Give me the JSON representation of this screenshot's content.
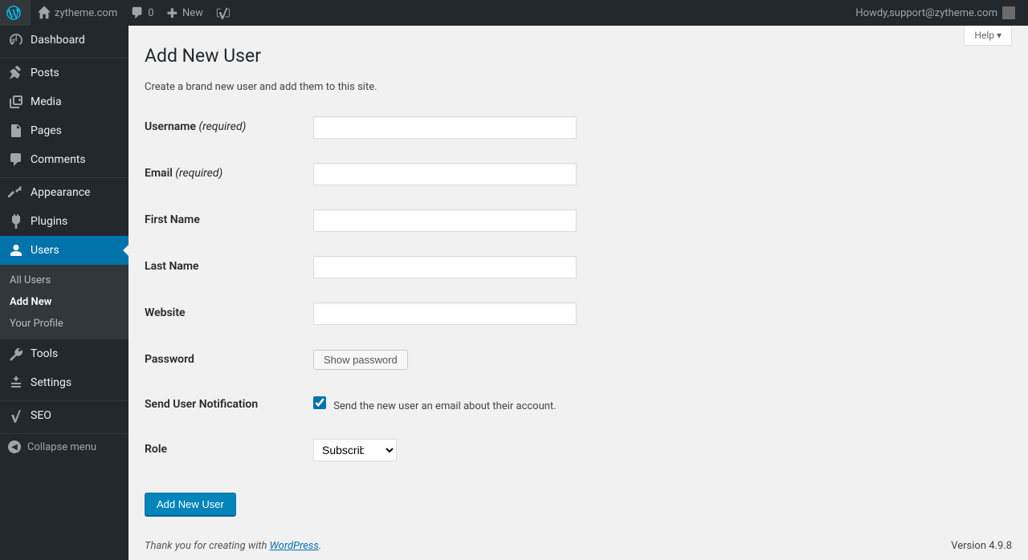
{
  "adminbar": {
    "site_name": "zytheme.com",
    "comments_count": "0",
    "new_label": "New",
    "howdy_prefix": "Howdy, ",
    "user": "support@zytheme.com"
  },
  "sidebar": {
    "dashboard": "Dashboard",
    "posts": "Posts",
    "media": "Media",
    "pages": "Pages",
    "comments": "Comments",
    "appearance": "Appearance",
    "plugins": "Plugins",
    "users": "Users",
    "tools": "Tools",
    "settings": "Settings",
    "seo": "SEO",
    "collapse": "Collapse menu",
    "submenu": {
      "all_users": "All Users",
      "add_new": "Add New",
      "your_profile": "Your Profile"
    }
  },
  "content": {
    "help_label": "Help ▾",
    "title": "Add New User",
    "desc": "Create a brand new user and add them to this site.",
    "labels": {
      "username": "Username ",
      "email": "Email ",
      "first_name": "First Name",
      "last_name": "Last Name",
      "website": "Website",
      "password": "Password",
      "send_notification": "Send User Notification",
      "role": "Role",
      "required": "(required)"
    },
    "buttons": {
      "show_password": "Show password",
      "submit": "Add New User"
    },
    "notification_text": "Send the new user an email about their account.",
    "role_options": [
      "Subscriber"
    ],
    "role_selected": "Subscriber"
  },
  "footer": {
    "thanks_prefix": "Thank you for creating with ",
    "wp_link": "WordPress",
    "version": "Version 4.9.8"
  }
}
